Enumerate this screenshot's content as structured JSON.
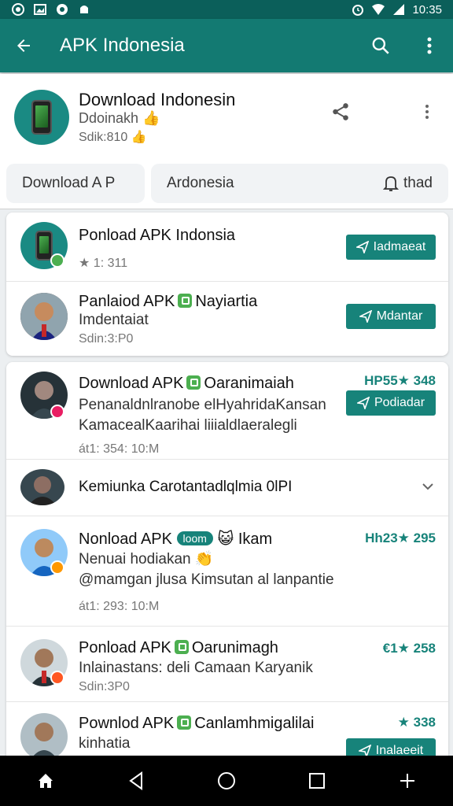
{
  "status": {
    "time": "10:35"
  },
  "app_bar": {
    "title": "APK Indonesia"
  },
  "header": {
    "title": "Download Indonesin",
    "sub1": "Ddoinakh 👍",
    "sub2": "Sdik:810 👍"
  },
  "tabs": {
    "first": "Download A P",
    "second": "Ardonesia",
    "second_right": "thad"
  },
  "items": [
    {
      "title": "Ponload APK Indonsia",
      "meta": "★ 1: 311",
      "button": "Iadmaeat"
    },
    {
      "title": "Panlaiod APK",
      "title_after": "Nayiartia",
      "line2": "Imdentaiat",
      "meta": "Sdin:3:P0",
      "button": "Mdantar"
    },
    {
      "title": "Download APK",
      "title_after": "Oaranimaiah",
      "line2": "Penanaldnlranobe elHyahridaKansan",
      "line3": "KamacealKaarihai liiialdlaeralegli",
      "meta": "át1: 354: 10:M",
      "rating": "HP55★ 348",
      "button": "Podiadar"
    },
    {
      "title": "Kemiunka Carotantadlqlmia 0lPI"
    },
    {
      "title": "Nonload APK",
      "pill": "loom",
      "title_after": "😺  Ikam",
      "line2": "Nenuai hodiakan 👏",
      "line3": "@mamgan jlusa Kimsutan al lanpantie",
      "meta": "át1: 293: 10:M",
      "rating": "Hh23★ 295"
    },
    {
      "title": "Ponload APK",
      "title_after": "Oarunimagh",
      "line2": "Inlainastans: deli Camaan Karyanik",
      "meta": "Sdin:3P0",
      "rating": "€1★ 258"
    },
    {
      "title": "Pownlod APK",
      "title_after": "Canlamhmigalilai",
      "line2": "kinhatia",
      "rating": "★ 338",
      "button": "Inalaeeit"
    }
  ],
  "colors": {
    "primary": "#137a72",
    "primary_dark": "#0b5f5a",
    "accent": "#17837a"
  }
}
